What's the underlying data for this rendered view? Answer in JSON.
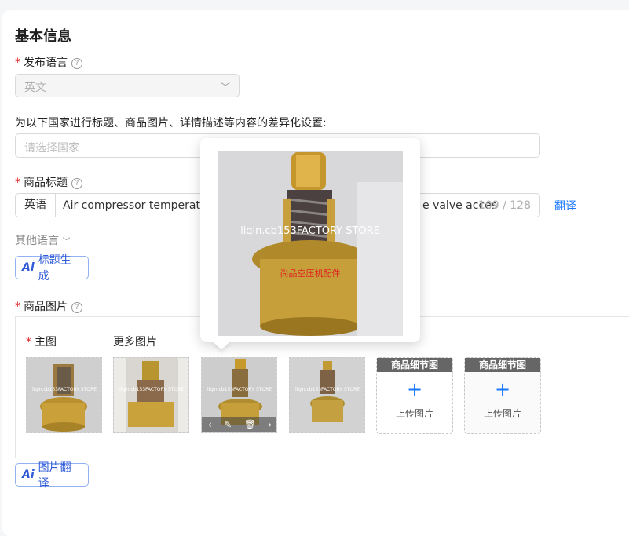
{
  "section": {
    "title": "基本信息"
  },
  "language": {
    "label": "发布语言",
    "value": "英文"
  },
  "country": {
    "label": "为以下国家进行标题、商品图片、详情描述等内容的差异化设置:",
    "placeholder": "请选择国家"
  },
  "product_title": {
    "label": "商品标题",
    "lang_addon": "英语",
    "text_start": "Air compressor temperature",
    "text_end": "e valve acces",
    "counter": "109 / 128",
    "translate_link": "翻译"
  },
  "other_languages": {
    "label": "其他语言"
  },
  "ai_title_button": {
    "ai": "Ai",
    "label": "标题生成"
  },
  "product_images": {
    "label": "商品图片",
    "main_label": "主图",
    "more_label": "更多图片",
    "watermark": "liqin.cb153FACTORY STORE",
    "overlay_text": "尚品空压机配件",
    "uploaders": [
      {
        "title": "商品细节图",
        "plus": "+",
        "text": "上传图片"
      },
      {
        "title": "商品细节图",
        "plus": "+",
        "text": "上传图片"
      }
    ]
  },
  "ai_image_button": {
    "ai": "Ai",
    "label": "图片翻译"
  },
  "icons": {
    "help": "question-circle-icon",
    "chevron": "chevron-down-icon",
    "prev": "chevron-left-icon",
    "next": "chevron-right-icon",
    "edit": "edit-icon",
    "delete": "trash-icon"
  },
  "colors": {
    "accent": "#1677ff",
    "required": "#e02020",
    "ai": "#2f5bd8"
  }
}
